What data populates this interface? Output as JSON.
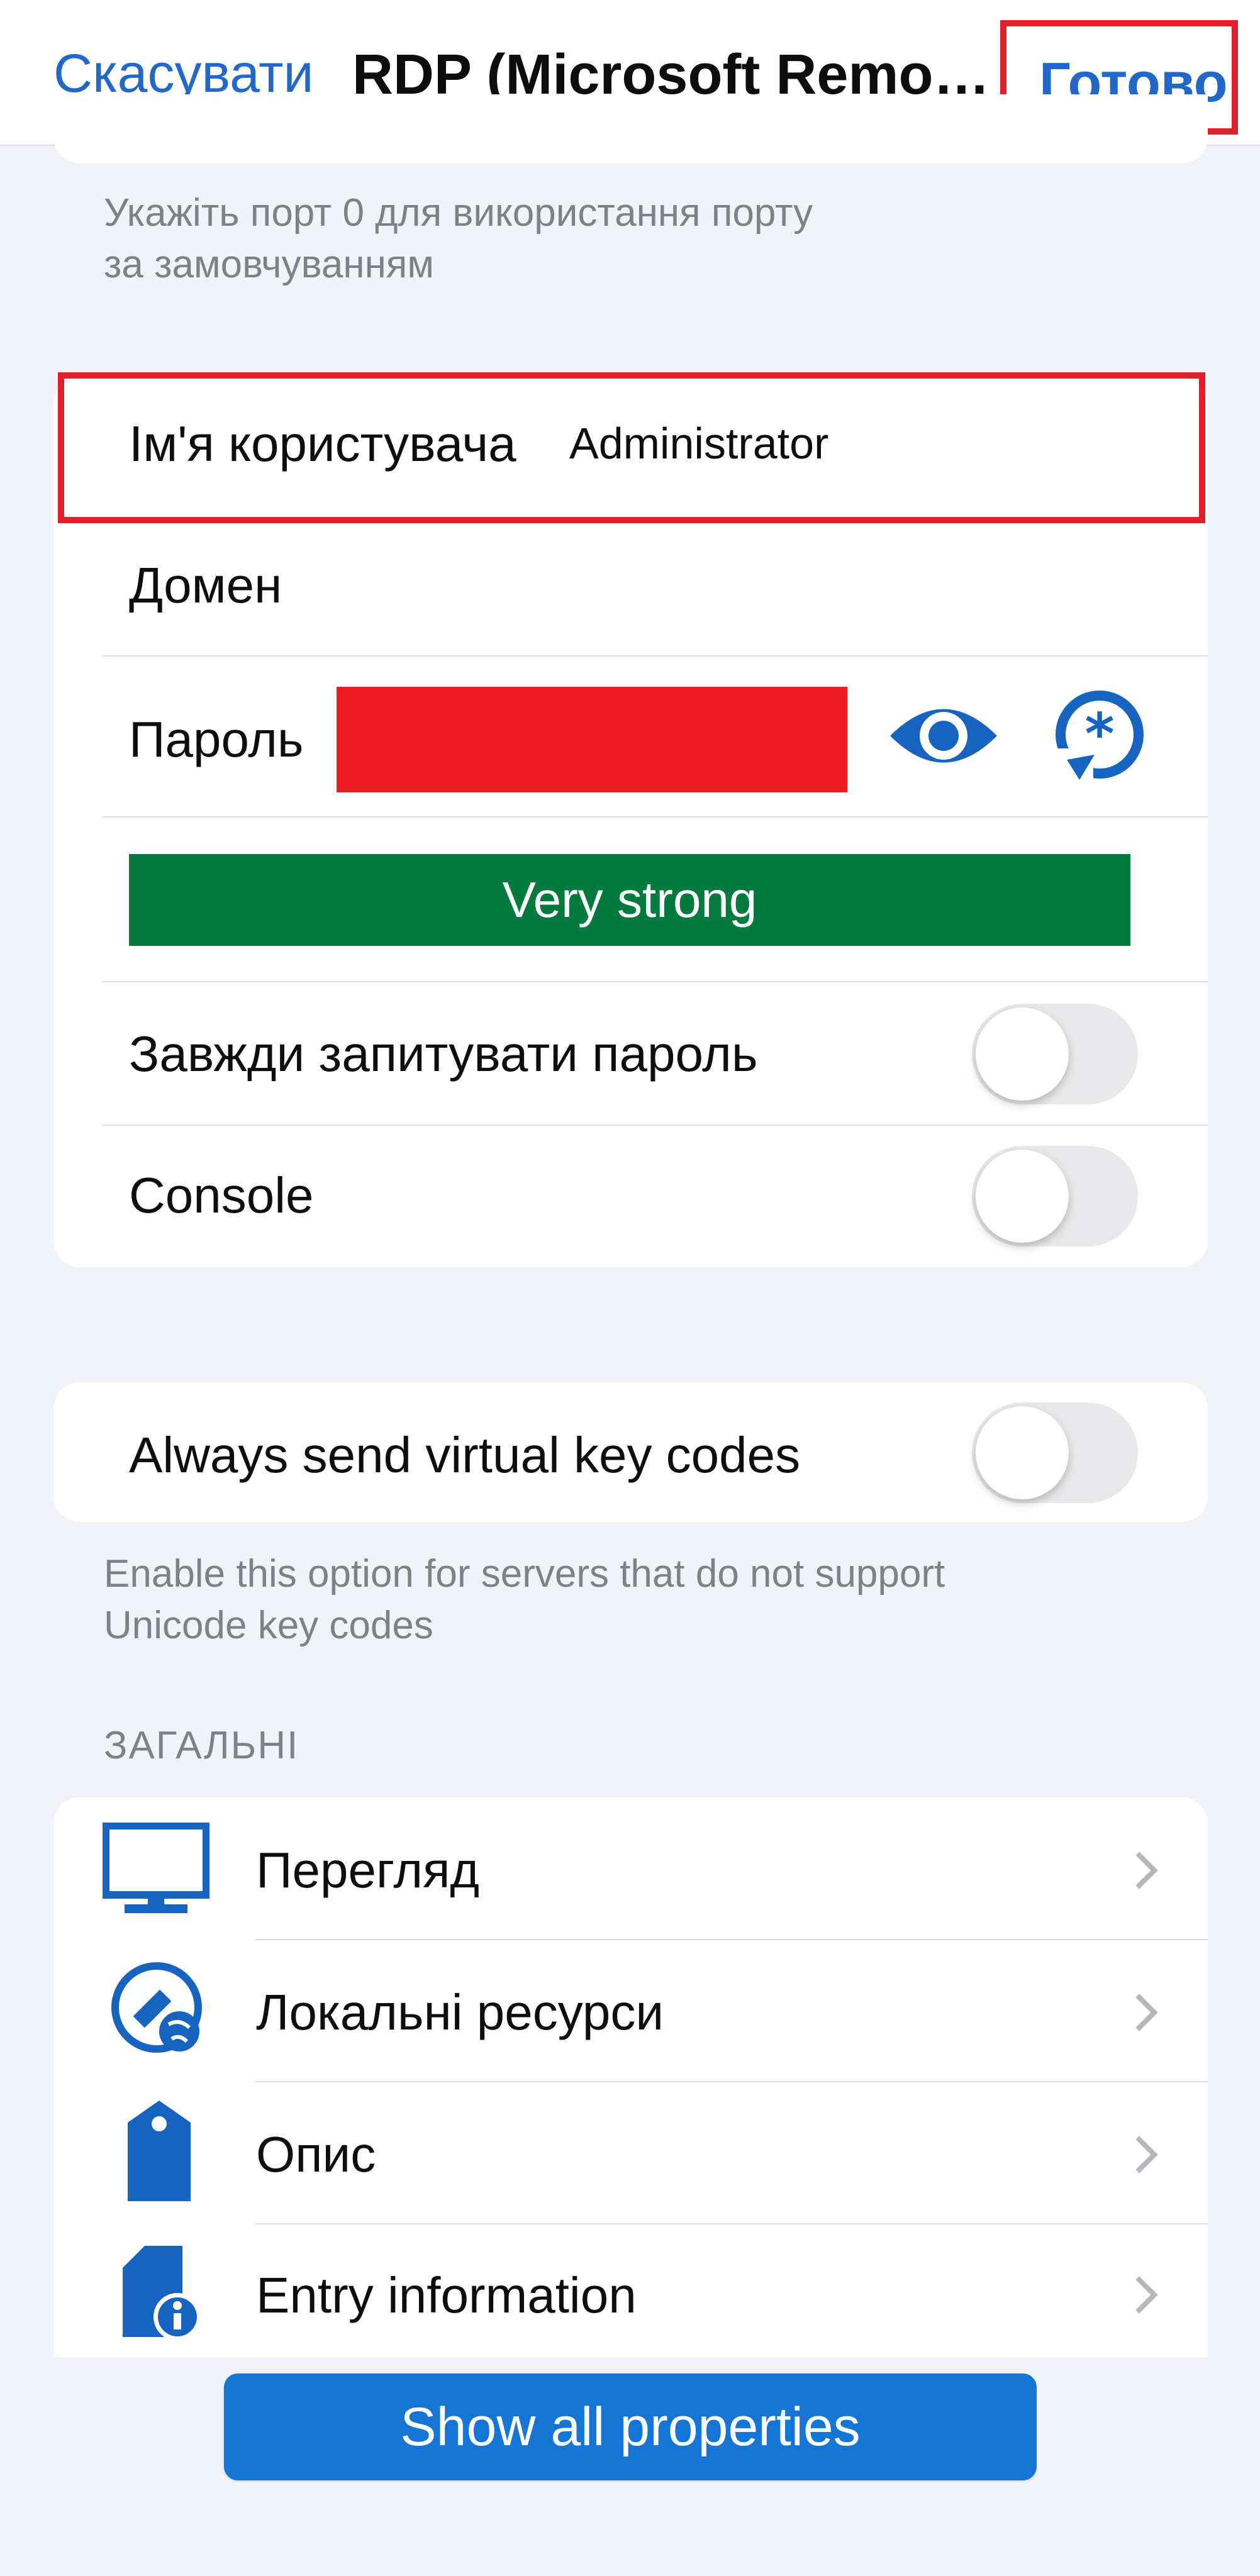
{
  "nav": {
    "cancel": "Скасувати",
    "title": "RDP (Microsoft Remote...",
    "done": "Готово"
  },
  "port_note": "Укажіть порт 0 для використання порту\nза замовчуванням",
  "credentials": {
    "username_label": "Ім'я користувача",
    "username_value": "Administrator",
    "domain_label": "Домен",
    "password_label": "Пароль",
    "strength": "Very strong",
    "always_ask_label": "Завжди запитувати пароль",
    "always_ask_on": false,
    "console_label": "Console",
    "console_on": false
  },
  "virtual_keys": {
    "label": "Always send virtual key codes",
    "on": false,
    "note": "Enable this option for servers that do not support\nUnicode key codes"
  },
  "general": {
    "header": "ЗАГАЛЬНІ",
    "items": [
      {
        "label": "Перегляд",
        "icon": "monitor-icon"
      },
      {
        "label": "Локальні ресурси",
        "icon": "local-resources-icon"
      },
      {
        "label": "Опис",
        "icon": "tag-icon"
      },
      {
        "label": "Entry information",
        "icon": "document-info-icon"
      }
    ]
  },
  "show_all_button": "Show all properties",
  "colors": {
    "accent": "#2168c9",
    "highlight": "#e31e2b",
    "strength_green": "#047a3f",
    "button_blue": "#1575d4"
  }
}
